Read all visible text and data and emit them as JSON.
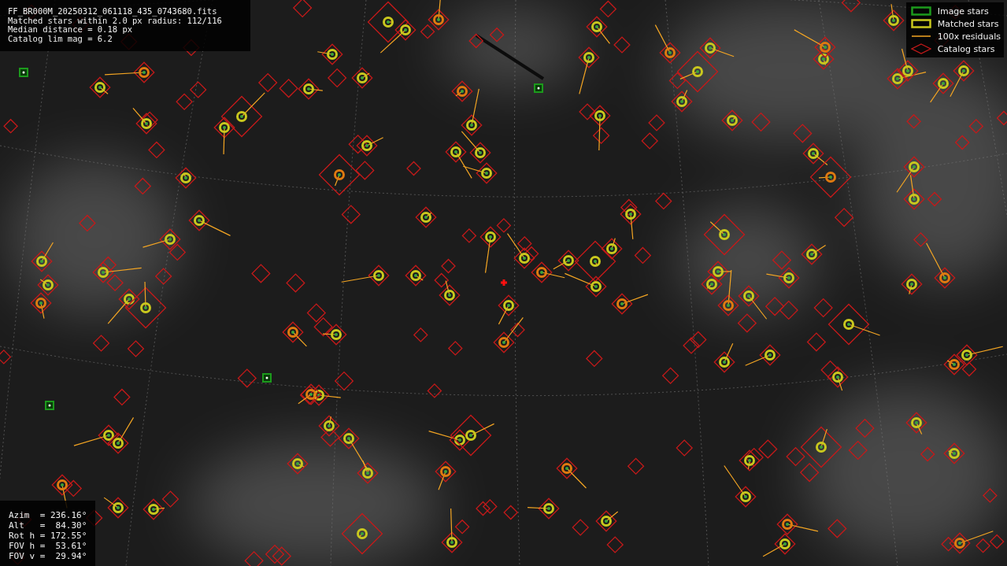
{
  "info_panel": {
    "lines": [
      "FF_BR000M_20250312_061118_435_0743680.fits",
      "Matched stars within 2.0 px radius: 112/116",
      "Median distance = 0.18 px",
      "Catalog lim mag = 6.2"
    ]
  },
  "legend": {
    "items": [
      {
        "kind": "image",
        "label": "Image stars"
      },
      {
        "kind": "matched",
        "label": "Matched stars"
      },
      {
        "kind": "residual",
        "label": "100x residuals"
      },
      {
        "kind": "catalog",
        "label": "Catalog stars"
      }
    ]
  },
  "pointing_panel": {
    "lines": [
      "Azim  = 236.16°",
      "Alt   =  84.30°",
      "Rot h = 172.55°",
      "FOV h =  53.61°",
      "FOV v =  29.94°"
    ]
  }
}
